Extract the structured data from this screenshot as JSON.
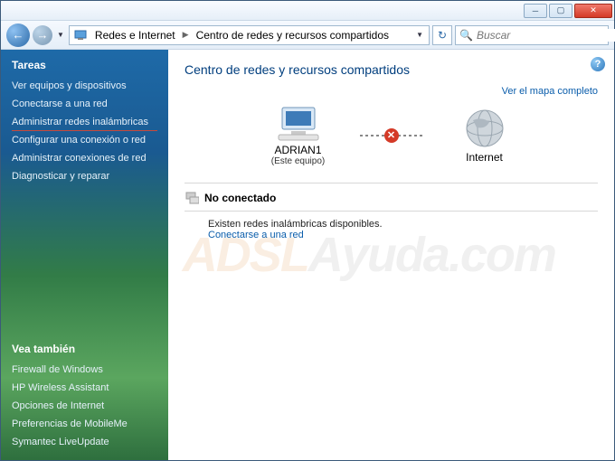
{
  "breadcrumb": {
    "level1": "Redes e Internet",
    "level2": "Centro de redes y recursos compartidos"
  },
  "search": {
    "placeholder": "Buscar"
  },
  "sidebar": {
    "tasks_heading": "Tareas",
    "tasks": [
      "Ver equipos y dispositivos",
      "Conectarse a una red",
      "Administrar redes inalámbricas",
      "Configurar una conexión o red",
      "Administrar conexiones de red",
      "Diagnosticar y reparar"
    ],
    "seealso_heading": "Vea también",
    "seealso": [
      "Firewall de Windows",
      "HP Wireless Assistant",
      "Opciones de Internet",
      "Preferencias de MobileMe",
      "Symantec LiveUpdate"
    ]
  },
  "main": {
    "title": "Centro de redes y recursos compartidos",
    "view_map": "Ver el mapa completo",
    "node_computer": "ADRIAN1",
    "node_computer_sub": "(Este equipo)",
    "node_internet": "Internet",
    "status_heading": "No conectado",
    "available_text": "Existen redes inalámbricas disponibles.",
    "connect_link": "Conectarse a una red"
  },
  "watermark": {
    "a": "ADSL",
    "b": "Ayuda.com"
  }
}
